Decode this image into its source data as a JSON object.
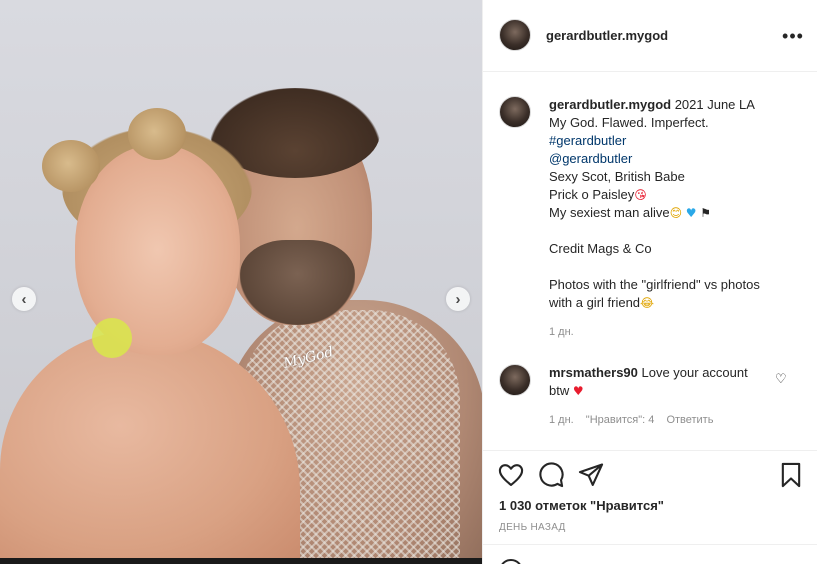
{
  "post": {
    "author": "gerardbutler.mygod",
    "watermark": "MyGod",
    "nav": {
      "prev": "‹",
      "next": "›"
    }
  },
  "header": {
    "username": "gerardbutler.mygod",
    "more_icon": "more-horizontal-icon",
    "more_label": "•••"
  },
  "caption": {
    "username": "gerardbutler.mygod",
    "first_line": " 2021 June LA",
    "lines": [
      "My God. Flawed. Imperfect.",
      "#gerardbutler",
      "@gerardbutler",
      "Sexy Scot, British Babe",
      "Prick o Paisley",
      "My sexiest man alive",
      "",
      "Credit Mags & Co",
      "",
      "Photos with the \"girlfriend\" vs photos",
      "with a girl friend"
    ],
    "emojis": {
      "wink_kiss": "😘",
      "grin": "😊",
      "blue_heart": "♥",
      "flag": "⚑",
      "laugh": "😂"
    },
    "time": "1 дн."
  },
  "comment": {
    "username": "mrsmathers90",
    "text": " Love your account",
    "text_line2": "btw ",
    "heart": "♥",
    "like_icon": "heart-outline-icon",
    "like_glyph": "♡",
    "time": "1 дн.",
    "likes": "\"Нравится\": 4",
    "reply": "Ответить"
  },
  "actions": {
    "like_icon": "heart-icon",
    "comment_icon": "speech-bubble-icon",
    "share_icon": "paper-plane-icon",
    "save_icon": "bookmark-icon",
    "likes_count": "1 030 отметок \"Нравится\"",
    "date": "ДЕНЬ НАЗАД"
  },
  "colors": {
    "link": "#00376b",
    "muted": "#8e8e8e",
    "text": "#262626",
    "border": "#efefef"
  }
}
